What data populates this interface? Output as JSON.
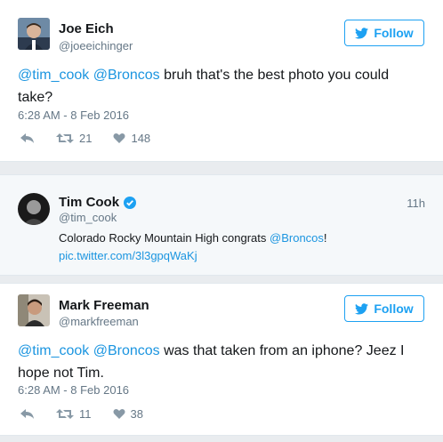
{
  "tweets": [
    {
      "name": "Joe Eich",
      "handle": "@joeeichinger",
      "follow_label": "Follow",
      "mention1": "@tim_cook",
      "mention2": "@Broncos",
      "text_rest": " bruh that's the best photo you could take?",
      "timestamp": "6:28 AM - 8 Feb 2016",
      "retweets": "21",
      "likes": "148"
    },
    {
      "name": "Mark Freeman",
      "handle": "@markfreeman",
      "follow_label": "Follow",
      "mention1": "@tim_cook",
      "mention2": "@Broncos",
      "text_rest": " was that taken from an iphone? Jeez I hope not Tim.",
      "timestamp": "6:28 AM - 8 Feb 2016",
      "retweets": "11",
      "likes": "38"
    }
  ],
  "quoted": {
    "name": "Tim Cook",
    "handle": "@tim_cook",
    "elapsed": "11h",
    "text_pre": "Colorado Rocky Mountain High congrats ",
    "mention": "@Broncos",
    "text_post": "!",
    "link": "pic.twitter.com/3l3gpqWaKj"
  },
  "colors": {
    "accent": "#1da1f2",
    "muted": "#657786",
    "link": "#1b95e0"
  }
}
